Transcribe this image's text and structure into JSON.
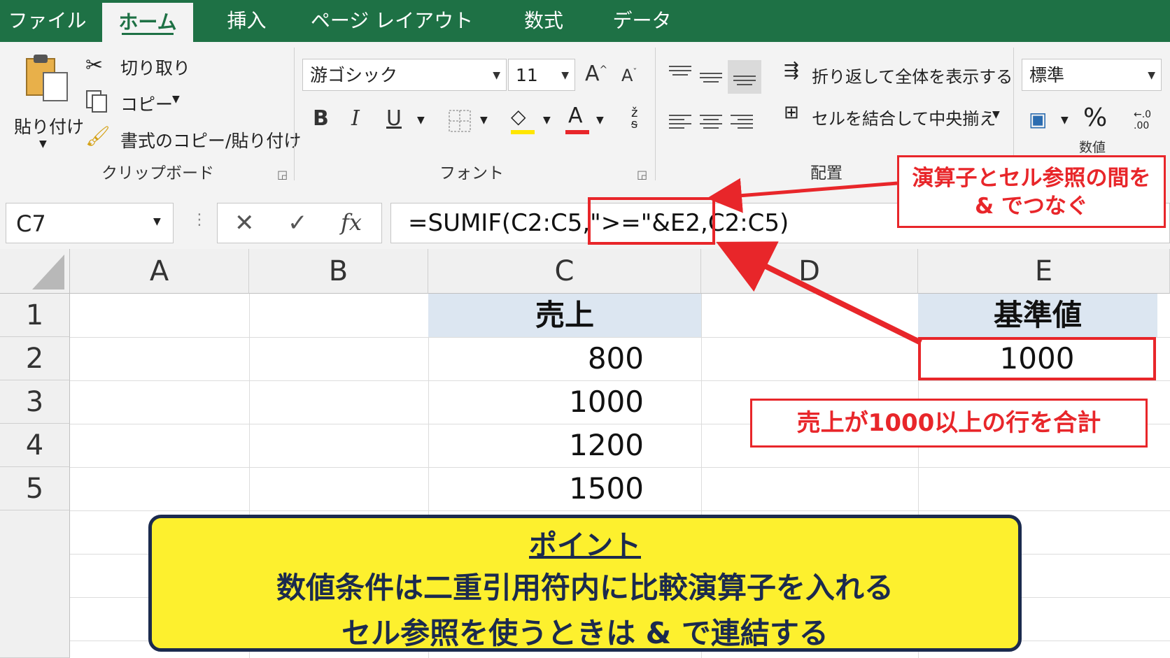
{
  "tabs": [
    {
      "label": "ファイル"
    },
    {
      "label": "ホーム"
    },
    {
      "label": "挿入"
    },
    {
      "label": "ページ レイアウト"
    },
    {
      "label": "数式"
    },
    {
      "label": "データ"
    }
  ],
  "clipboard": {
    "paste": "貼り付け",
    "cut": "切り取り",
    "copy": "コピー",
    "format_painter": "書式のコピー/貼り付け",
    "group": "クリップボード"
  },
  "font": {
    "name": "游ゴシック",
    "size": "11",
    "grow": "A",
    "shrink": "A",
    "bold": "B",
    "italic": "I",
    "underline": "U",
    "font_color": "A",
    "group": "フォント"
  },
  "alignment": {
    "wrap": "折り返して全体を表示する",
    "merge": "セルを結合して中央揃え",
    "group": "配置"
  },
  "number": {
    "format": "標準",
    "percent": "%",
    "group": "数値",
    "decimals": "←.0 .00"
  },
  "formula_bar": {
    "name_box": "C7",
    "cancel": "✕",
    "enter": "✓",
    "fx": "fx",
    "formula": "=SUMIF(C2:C5,\">=\"&E2,C2:C5)"
  },
  "grid": {
    "columns": [
      "A",
      "B",
      "C",
      "D",
      "E"
    ],
    "rows": [
      "1",
      "2",
      "3",
      "4",
      "5"
    ],
    "C1": "売上",
    "C2": "800",
    "C3": "1000",
    "C4": "1200",
    "C5": "1500",
    "E1": "基準値",
    "E2": "1000"
  },
  "callouts": {
    "top_line1": "演算子とセル参照の間を",
    "top_line2": "& でつなぐ",
    "middle": "売上が1000以上の行を合計"
  },
  "point": {
    "title": "ポイント",
    "line1": "数値条件は二重引用符内に比較演算子を入れる",
    "line2": "セル参照を使うときは & で連結する"
  },
  "colors": {
    "excel_green": "#1e7145",
    "callout_red": "#e8262a",
    "point_yellow": "#fdf02e",
    "header_fill": "#dce6f1"
  }
}
